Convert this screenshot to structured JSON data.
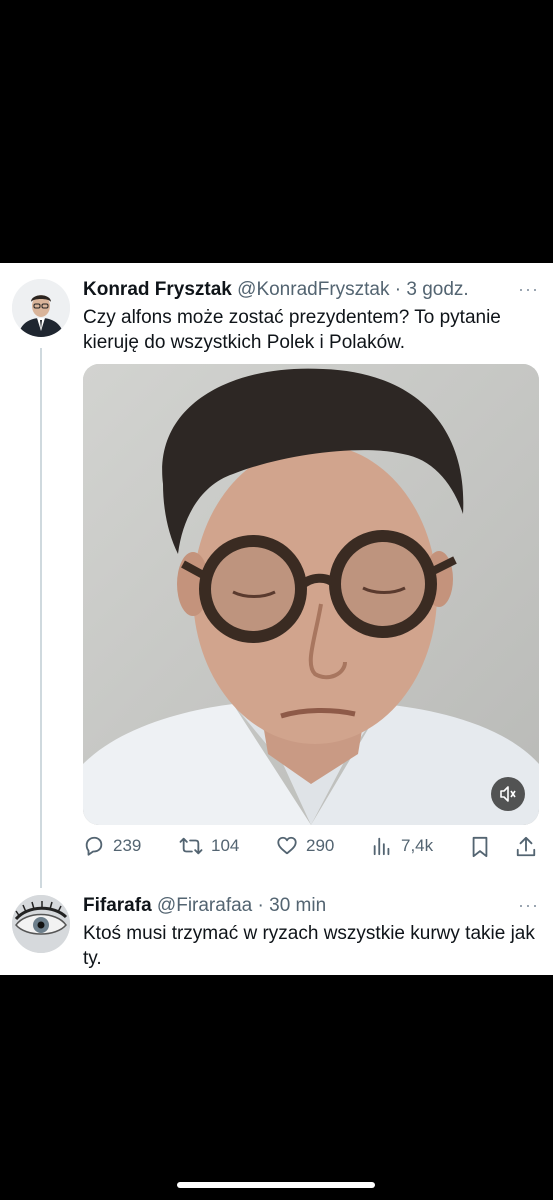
{
  "tweet": {
    "author_name": "Konrad Frysztak",
    "handle": "@KonradFrysztak",
    "separator": "·",
    "time": "3 godz.",
    "more": "···",
    "text": "Czy alfons może zostać prezydentem? To pytanie kieruję do wszystkich Polek i Polaków.",
    "media": {
      "mute_icon": "speaker-muted-icon"
    },
    "actions": {
      "replies": "239",
      "reposts": "104",
      "likes": "290",
      "views": "7,4k"
    }
  },
  "reply": {
    "author_name": "Fifarafa",
    "handle": "@Firarafaa",
    "separator": "·",
    "time": "30 min",
    "more": "···",
    "text": "Ktoś musi trzymać w ryzach wszystkie kurwy takie jak ty."
  },
  "colors": {
    "text": "#0f1419",
    "secondary": "#536471",
    "thread_line": "#cfd9de"
  }
}
